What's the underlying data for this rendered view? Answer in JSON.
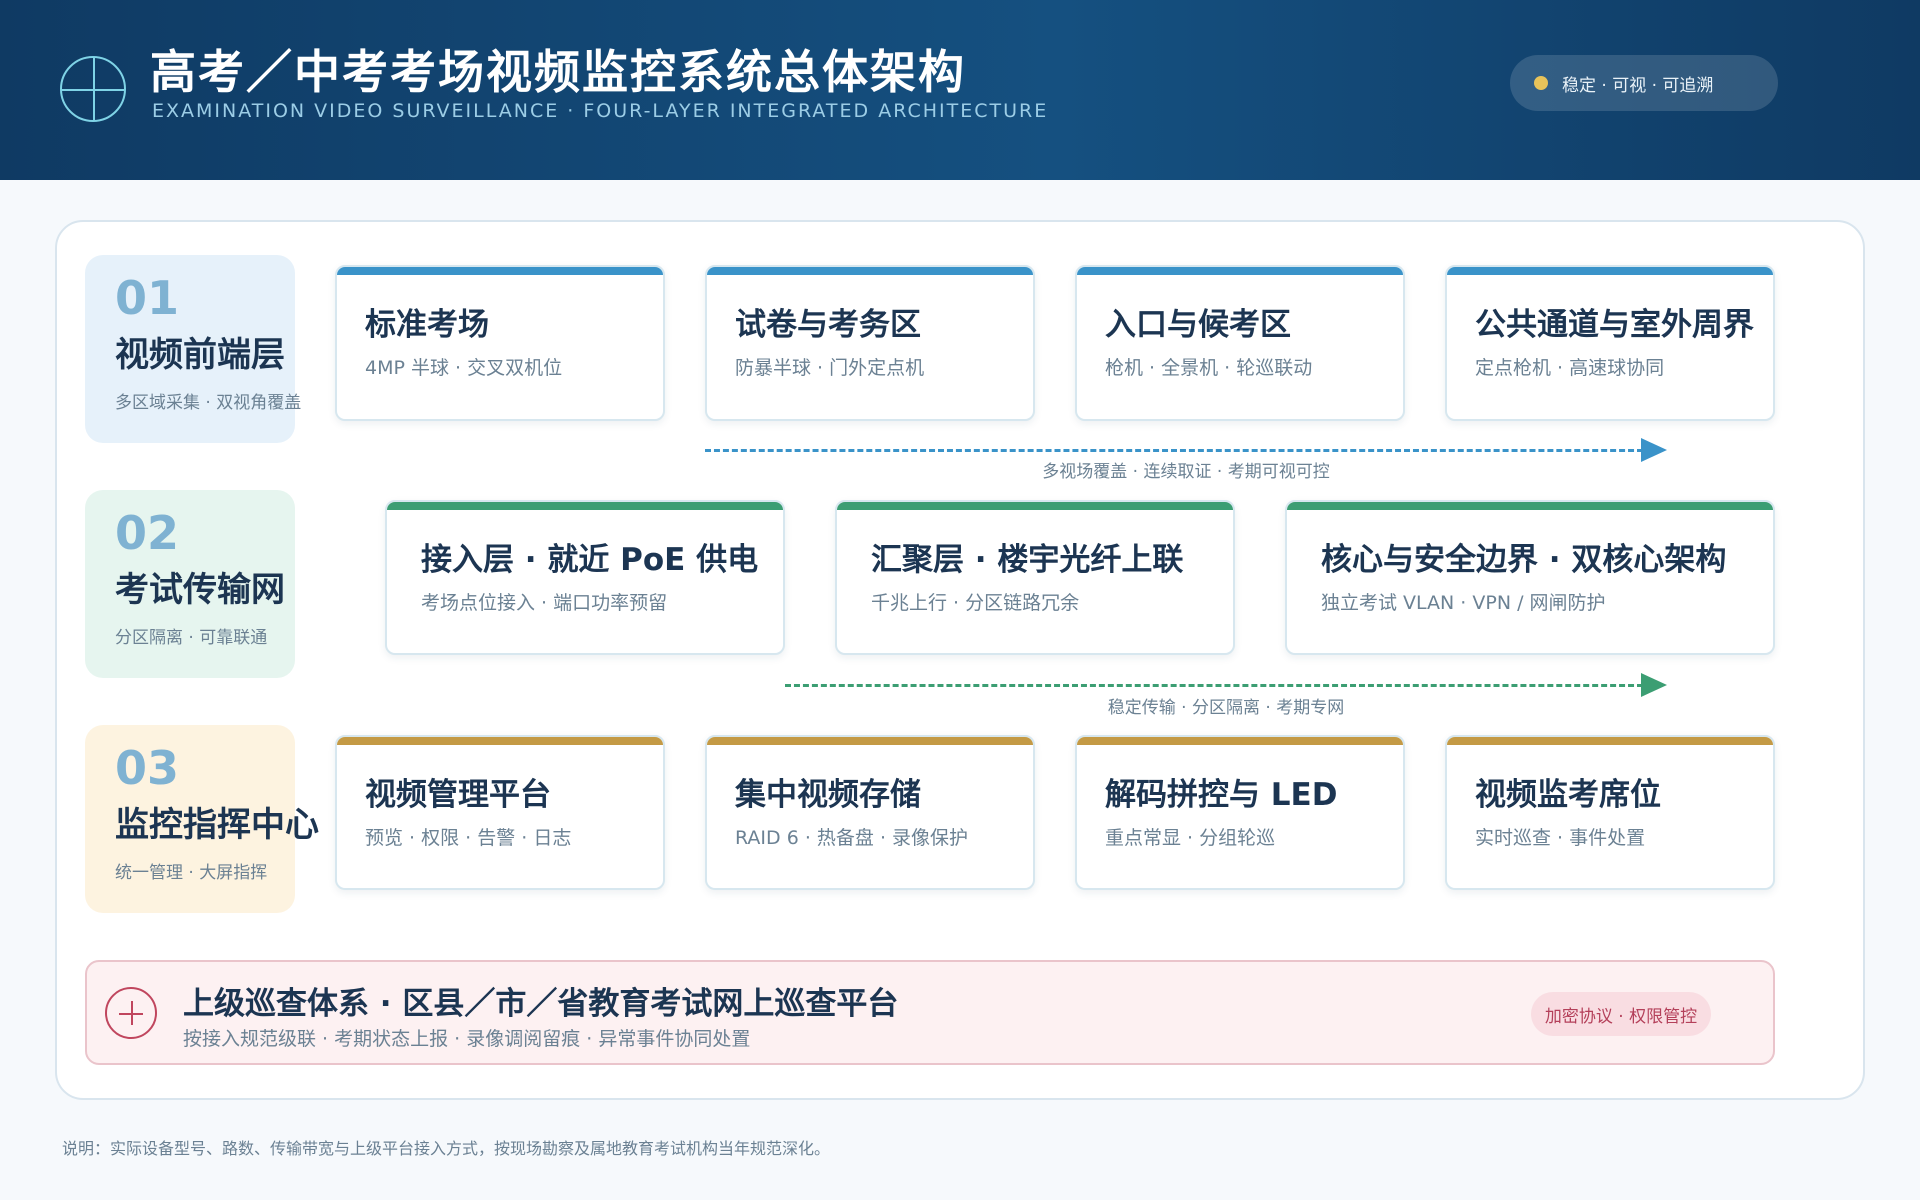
{
  "header": {
    "title": "高考／中考考场视频监控系统总体架构",
    "subtitle": "EXAMINATION VIDEO SURVEILLANCE · FOUR-LAYER INTEGRATED ARCHITECTURE",
    "pill_text": "稳定 · 可视 · 可追溯",
    "colors": {
      "background": "#0f3a63",
      "accent": "#7fd3e6",
      "pill_dot": "#e8c35a"
    }
  },
  "layers": [
    {
      "num": "01",
      "name": "视频前端层",
      "desc": "多区域采集 · 双视角覆盖",
      "color": "#3a93c9",
      "bg": "#e6f1fa",
      "cards": [
        {
          "title": "标准考场",
          "sub": "4MP 半球 · 交叉双机位"
        },
        {
          "title": "试卷与考务区",
          "sub": "防暴半球 · 门外定点机"
        },
        {
          "title": "入口与候考区",
          "sub": "枪机 · 全景机 · 轮巡联动"
        },
        {
          "title": "公共通道与室外周界",
          "sub": "定点枪机 · 高速球协同"
        }
      ],
      "flow_label": "多视场覆盖 · 连续取证 · 考期可视可控"
    },
    {
      "num": "02",
      "name": "考试传输网",
      "desc": "分区隔离 · 可靠联通",
      "color": "#3c9e73",
      "bg": "#e6f5ef",
      "cards": [
        {
          "title": "接入层 · 就近 PoE 供电",
          "sub": "考场点位接入 · 端口功率预留"
        },
        {
          "title": "汇聚层 · 楼宇光纤上联",
          "sub": "千兆上行 · 分区链路冗余"
        },
        {
          "title": "核心与安全边界 · 双核心架构",
          "sub": "独立考试 VLAN · VPN / 网闸防护"
        }
      ],
      "flow_label": "稳定传输 · 分区隔离 · 考期专网"
    },
    {
      "num": "03",
      "name": "监控指挥中心",
      "desc": "统一管理 · 大屏指挥",
      "color": "#c49a45",
      "bg": "#fdf3e0",
      "cards": [
        {
          "title": "视频管理平台",
          "sub": "预览 · 权限 · 告警 · 日志"
        },
        {
          "title": "集中视频存储",
          "sub": "RAID 6 · 热备盘 · 录像保护"
        },
        {
          "title": "解码拼控与 LED",
          "sub": "重点常显 · 分组轮巡"
        },
        {
          "title": "视频监考席位",
          "sub": "实时巡查 · 事件处置"
        }
      ]
    }
  ],
  "upper": {
    "title": "上级巡查体系 · 区县／市／省教育考试网上巡查平台",
    "sub": "按接入规范级联 · 考期状态上报 · 录像调阅留痕 · 异常事件协同处置",
    "badge": "加密协议 · 权限管控",
    "color": "#c0465e"
  },
  "note": "说明：实际设备型号、路数、传输带宽与上级平台接入方式，按现场勘察及属地教育考试机构当年规范深化。"
}
